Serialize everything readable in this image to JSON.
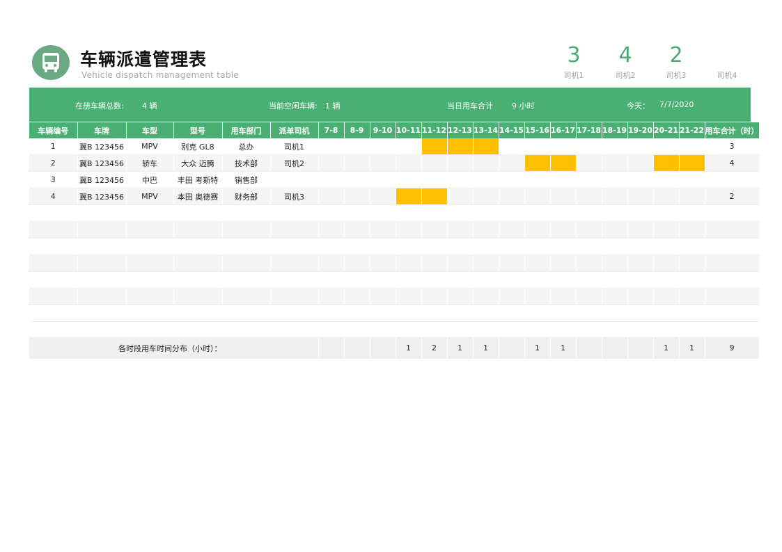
{
  "header": {
    "title": "车辆派遣管理表",
    "subtitle": "Vehicle dispatch management table",
    "logo_icon": "bus-icon"
  },
  "stats": [
    {
      "value": "3",
      "label": "司机1"
    },
    {
      "value": "4",
      "label": "司机2"
    },
    {
      "value": "2",
      "label": "司机3"
    },
    {
      "value": "",
      "label": "司机4"
    }
  ],
  "summary": {
    "total_label": "在册车辆总数:",
    "total_value": "4 辆",
    "idle_label": "当前空闲车辆:",
    "idle_value": "1 辆",
    "usage_label": "当日用车合计",
    "usage_value": "9 小时",
    "today_label": "今天：",
    "today_value": "7/7/2020"
  },
  "table": {
    "headers": [
      "车辆编号",
      "车牌",
      "车型",
      "型号",
      "用车部门",
      "派单司机",
      "7-8",
      "8-9",
      "9-10",
      "10-11",
      "11-12",
      "12-13",
      "13-14",
      "14-15",
      "15-16",
      "16-17",
      "17-18",
      "18-19",
      "19-20",
      "20-21",
      "21-22",
      "用车合计（时）"
    ],
    "rows": [
      {
        "cells": [
          "1",
          "冀B 123456",
          "MPV",
          "别克 GL8",
          "总办",
          "司机1"
        ],
        "busy": [
          0,
          0,
          0,
          0,
          1,
          1,
          1,
          0,
          0,
          0,
          0,
          0,
          0,
          0,
          0
        ],
        "total": "3"
      },
      {
        "cells": [
          "2",
          "冀B 123456",
          "轿车",
          "大众 迈腾",
          "技术部",
          "司机2"
        ],
        "busy": [
          0,
          0,
          0,
          0,
          0,
          0,
          0,
          0,
          1,
          1,
          0,
          0,
          0,
          1,
          1
        ],
        "total": "4"
      },
      {
        "cells": [
          "3",
          "冀B 123456",
          "中巴",
          "丰田 考斯特",
          "销售部",
          ""
        ],
        "busy": [
          0,
          0,
          0,
          0,
          0,
          0,
          0,
          0,
          0,
          0,
          0,
          0,
          0,
          0,
          0
        ],
        "total": ""
      },
      {
        "cells": [
          "4",
          "冀B 123456",
          "MPV",
          "本田 奥德赛",
          "财务部",
          "司机3"
        ],
        "busy": [
          0,
          0,
          0,
          1,
          1,
          0,
          0,
          0,
          0,
          0,
          0,
          0,
          0,
          0,
          0
        ],
        "total": "2"
      }
    ],
    "empty_rows": 7,
    "distribution_label": "各时段用车时间分布（小时）：",
    "distribution": [
      "",
      "",
      "",
      "1",
      "2",
      "1",
      "1",
      "",
      "1",
      "1",
      "",
      "",
      "",
      "1",
      "1"
    ],
    "distribution_total": "9"
  },
  "colors": {
    "accent": "#4aaf73",
    "busy": "#ffc000",
    "stat_number": "#4aaa73"
  }
}
